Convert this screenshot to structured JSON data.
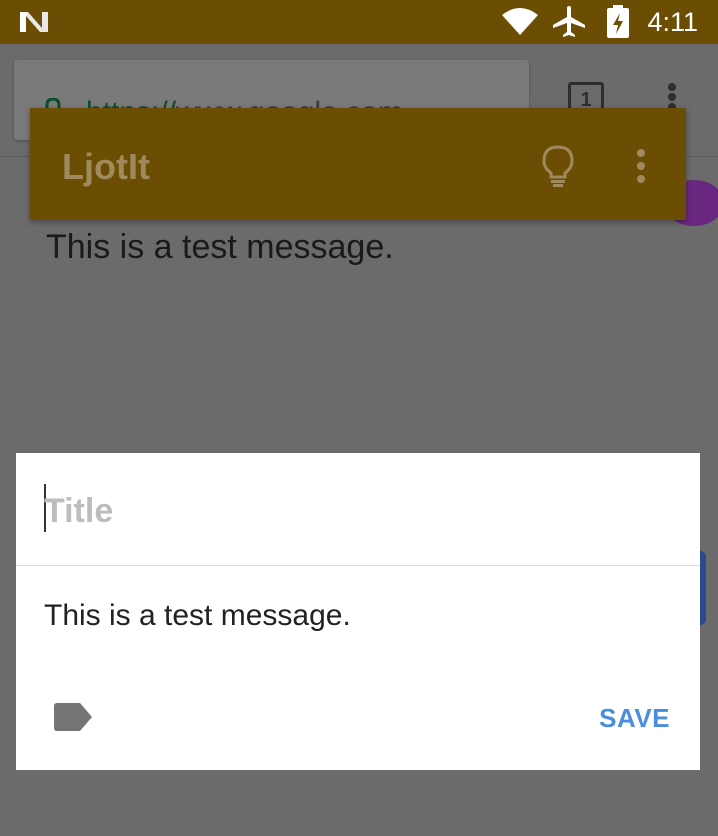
{
  "status_bar": {
    "time": "4:11",
    "icons": [
      "n-logo-icon",
      "wifi-icon",
      "airplane-mode-icon",
      "battery-charging-icon"
    ],
    "background": "#6b4e04"
  },
  "browser": {
    "url_scheme": "https://",
    "url_host": "www.google.com",
    "tab_count": "1",
    "page_text": "This is a test message."
  },
  "app": {
    "title": "LjotIt",
    "toolbar_color": "#6b4e04",
    "icons": [
      "lightbulb-icon",
      "overflow-menu-icon"
    ]
  },
  "dialog": {
    "title_placeholder": "Title",
    "title_value": "",
    "body_text": "This is a test message.",
    "save_label": "SAVE",
    "accent_color": "#4a8fde",
    "icons": [
      "label-tag-icon"
    ]
  }
}
